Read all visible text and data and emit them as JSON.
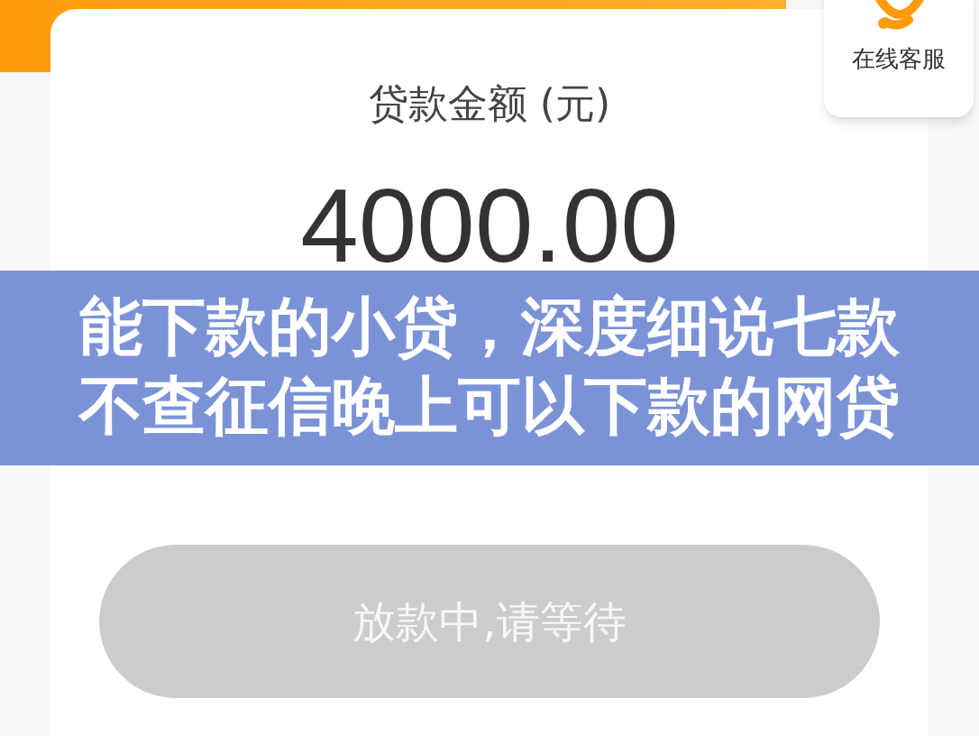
{
  "loan_card": {
    "label": "贷款金额 (元)",
    "amount": "4000.00"
  },
  "service_widget": {
    "label": "在线客服"
  },
  "banner": {
    "lines": [
      "能下款的小贷，深度细说七款",
      "不查征信晚上可以下款的网贷"
    ]
  },
  "status_button": {
    "label": "放款中,请等待",
    "disabled": true
  }
}
